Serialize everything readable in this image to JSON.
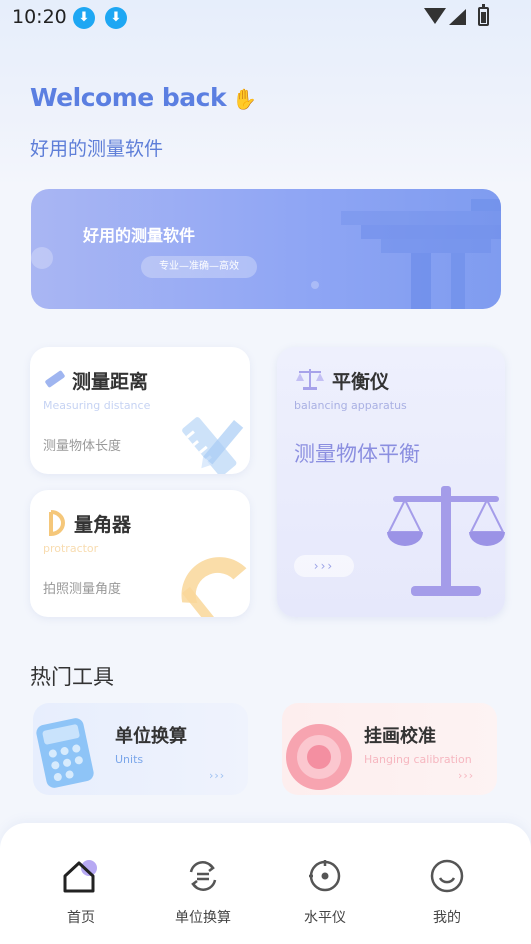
{
  "status": {
    "time": "10:20"
  },
  "header": {
    "welcome": "Welcome back",
    "subtitle": "好用的测量软件"
  },
  "banner": {
    "title": "好用的测量软件",
    "tagline": "专业—准确—高效"
  },
  "cards": {
    "distance": {
      "title": "测量距离",
      "en": "Measuring distance",
      "desc": "测量物体长度"
    },
    "angle": {
      "title": "量角器",
      "en": "protractor",
      "desc": "拍照测量角度"
    },
    "balance": {
      "title": "平衡仪",
      "en": "balancing apparatus",
      "desc": "测量物体平衡",
      "arrows": "›››"
    }
  },
  "hot_tools": {
    "title": "热门工具",
    "items": [
      {
        "title": "单位换算",
        "en": "Units",
        "arrows": "›››"
      },
      {
        "title": "挂画校准",
        "en": "Hanging calibration",
        "arrows": "›››"
      }
    ]
  },
  "tabbar": {
    "items": [
      {
        "label": "首页",
        "icon": "home-icon",
        "active": true
      },
      {
        "label": "单位换算",
        "icon": "convert-icon",
        "active": false
      },
      {
        "label": "水平仪",
        "icon": "level-icon",
        "active": false
      },
      {
        "label": "我的",
        "icon": "profile-icon",
        "active": false
      }
    ]
  },
  "colors": {
    "accent": "#5b7fe1",
    "banner": "#8ea5f4",
    "balance": "#8b8fe0",
    "calibration": "#f48fa1"
  }
}
